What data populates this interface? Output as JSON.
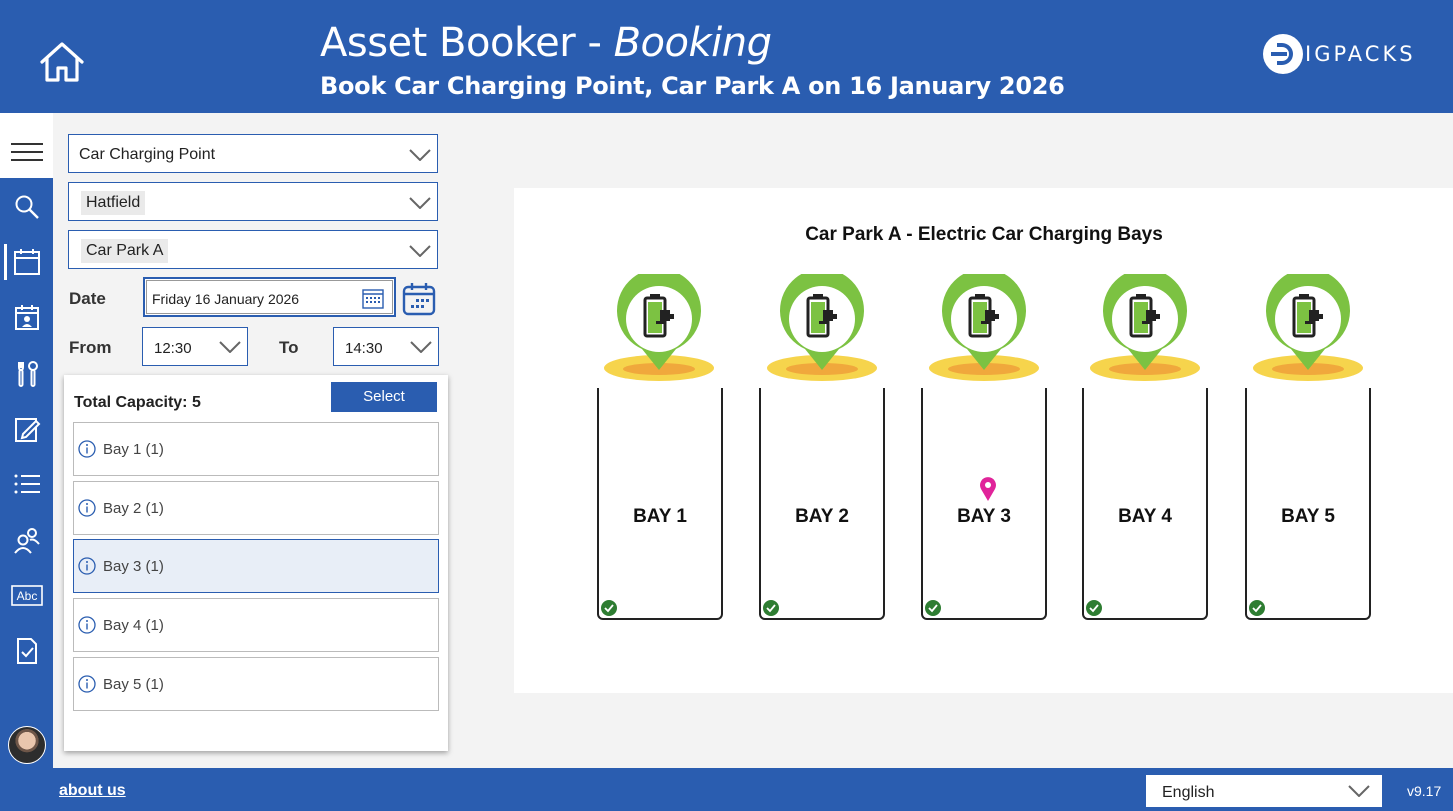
{
  "header": {
    "title_main": "Asset Booker - ",
    "title_italic": "Booking",
    "subtitle": "Book Car Charging Point, Car Park A on 16 January 2026",
    "logo_text": "IGPACKS"
  },
  "form": {
    "asset_type": "Car Charging Point",
    "site": "Hatfield",
    "location": "Car Park A",
    "date_label": "Date",
    "date_value": "Friday 16 January 2026",
    "from_label": "From",
    "from_value": "12:30",
    "to_label": "To",
    "to_value": "14:30"
  },
  "capacity": {
    "label": "Total Capacity: 5",
    "select_button": "Select",
    "bays": [
      {
        "label": "Bay 1 (1)",
        "selected": false
      },
      {
        "label": "Bay 2 (1)",
        "selected": false
      },
      {
        "label": "Bay 3 (1)",
        "selected": true
      },
      {
        "label": "Bay 4 (1)",
        "selected": false
      },
      {
        "label": "Bay 5 (1)",
        "selected": false
      }
    ]
  },
  "diagram": {
    "title": "Car Park A - Electric Car Charging Bays",
    "bays": [
      "BAY 1",
      "BAY 2",
      "BAY 3",
      "BAY 4",
      "BAY 5"
    ],
    "selected_bay": "BAY 3"
  },
  "footer": {
    "about": "about us",
    "language": "English",
    "version": "v9.17"
  },
  "colors": {
    "brand_blue": "#2a5db0",
    "pin_green": "#7cc242",
    "pad_yellow": "#f6d44c",
    "pink_marker": "#e0249a",
    "check_green": "#2e7d32"
  },
  "icons": {
    "nav": [
      "menu-icon",
      "search-icon",
      "calendar-icon",
      "calendar-person-icon",
      "tools-icon",
      "edit-icon",
      "list-icon",
      "users-icon",
      "abc-icon",
      "checklist-icon"
    ]
  }
}
